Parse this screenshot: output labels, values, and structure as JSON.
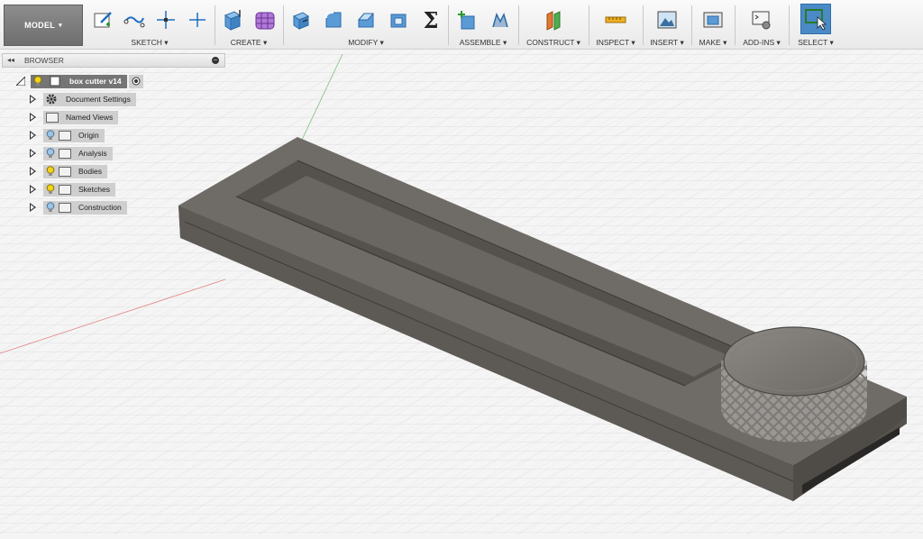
{
  "workspace": {
    "label": "MODEL"
  },
  "toolbar": {
    "groups": [
      {
        "label": "SKETCH"
      },
      {
        "label": "CREATE"
      },
      {
        "label": "MODIFY"
      },
      {
        "label": "ASSEMBLE"
      },
      {
        "label": "CONSTRUCT"
      },
      {
        "label": "INSPECT"
      },
      {
        "label": "INSERT"
      },
      {
        "label": "MAKE"
      },
      {
        "label": "ADD-INS"
      },
      {
        "label": "SELECT"
      }
    ],
    "caret": "▾",
    "sigma": "Σ"
  },
  "browser": {
    "title": "BROWSER",
    "collapse_glyph": "◂◂",
    "root": {
      "label": "box cutter v14"
    },
    "items": [
      {
        "label": "Document Settings",
        "icon": "gear-icon"
      },
      {
        "label": "Named Views",
        "icon": "folder-icon"
      },
      {
        "label": "Origin",
        "icon": "folder-icon",
        "light": "off"
      },
      {
        "label": "Analysis",
        "icon": "folder-icon",
        "light": "off"
      },
      {
        "label": "Bodies",
        "icon": "folder-icon",
        "light": "on"
      },
      {
        "label": "Sketches",
        "icon": "folder-icon",
        "light": "on"
      },
      {
        "label": "Construction",
        "icon": "folder-icon",
        "light": "off"
      }
    ]
  },
  "colors": {
    "model_top": "#6f6b66",
    "model_side": "#5a5752",
    "select_active": "#4a8ac6",
    "bulb_on": "#f3d21b",
    "bulb_off": "#9ec3e6"
  }
}
